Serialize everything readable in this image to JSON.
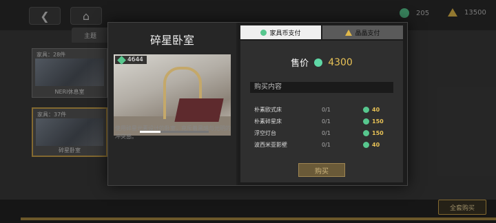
{
  "header": {
    "back_icon": "chevron-left-icon",
    "home_icon": "home-icon",
    "coin_amount": "205",
    "crystal_amount": "13500"
  },
  "sidebar": {
    "theme_tab_label": "主题",
    "cards": [
      {
        "count": "家具：28件",
        "name": "NERI休息室"
      },
      {
        "count": "家具：37件",
        "name": "碎星卧室"
      }
    ]
  },
  "bottom": {
    "full_buy_label": "全套购买"
  },
  "modal": {
    "title": "碎星卧室",
    "preview_badge": "4644",
    "description": "使用碎星元素设计的卧室，充斥着黑暗与光明的冲突感。",
    "tabs": [
      {
        "label": "家具币支付",
        "icon": "furniture-coin-icon"
      },
      {
        "label": "晶晶支付",
        "icon": "crystal-icon"
      }
    ],
    "price_label": "售价",
    "price_value": "4300",
    "buy_content_label": "购买内容",
    "items": [
      {
        "name": "朴素欧式床",
        "qty": "0/1",
        "price": "40"
      },
      {
        "name": "朴素碎星床",
        "qty": "0/1",
        "price": "150"
      },
      {
        "name": "浮空灯台",
        "qty": "0/1",
        "price": "150"
      },
      {
        "name": "波西米亚影壁",
        "qty": "0/1",
        "price": "40"
      }
    ],
    "buy_button_label": "购买"
  },
  "colors": {
    "accent_gold": "#c9a24a",
    "price_gold": "#e8c256",
    "coin_green": "#57c78e"
  }
}
